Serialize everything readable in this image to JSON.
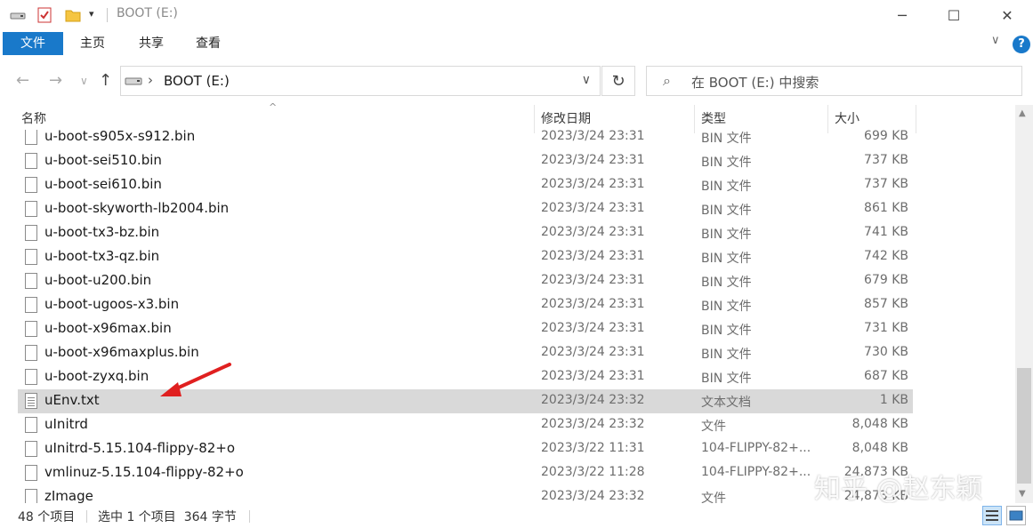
{
  "window": {
    "title": "BOOT (E:)",
    "minimize_glyph": "─",
    "maximize_glyph": "☐",
    "close_glyph": "✕"
  },
  "ribbon": {
    "tabs": [
      "文件",
      "主页",
      "共享",
      "查看"
    ],
    "help_glyph": "?",
    "expand_glyph": "∨"
  },
  "nav": {
    "back_glyph": "←",
    "forward_glyph": "→",
    "recent_glyph": "∨",
    "up_glyph": "↑",
    "address_text": "BOOT (E:)",
    "address_chevron": "›",
    "address_dropdown": "∨",
    "refresh_glyph": "↻",
    "search_placeholder": "在 BOOT (E:) 中搜索",
    "search_glyph": "⌕"
  },
  "columns": {
    "name": "名称",
    "date": "修改日期",
    "type": "类型",
    "size": "大小",
    "sort_glyph": "^"
  },
  "files": [
    {
      "name": "u-boot-s905x-s912.bin",
      "date": "2023/3/24 23:31",
      "type": "BIN 文件",
      "size": "699 KB",
      "icon": "file-icon",
      "selected": false
    },
    {
      "name": "u-boot-sei510.bin",
      "date": "2023/3/24 23:31",
      "type": "BIN 文件",
      "size": "737 KB",
      "icon": "file-icon",
      "selected": false
    },
    {
      "name": "u-boot-sei610.bin",
      "date": "2023/3/24 23:31",
      "type": "BIN 文件",
      "size": "737 KB",
      "icon": "file-icon",
      "selected": false
    },
    {
      "name": "u-boot-skyworth-lb2004.bin",
      "date": "2023/3/24 23:31",
      "type": "BIN 文件",
      "size": "861 KB",
      "icon": "file-icon",
      "selected": false
    },
    {
      "name": "u-boot-tx3-bz.bin",
      "date": "2023/3/24 23:31",
      "type": "BIN 文件",
      "size": "741 KB",
      "icon": "file-icon",
      "selected": false
    },
    {
      "name": "u-boot-tx3-qz.bin",
      "date": "2023/3/24 23:31",
      "type": "BIN 文件",
      "size": "742 KB",
      "icon": "file-icon",
      "selected": false
    },
    {
      "name": "u-boot-u200.bin",
      "date": "2023/3/24 23:31",
      "type": "BIN 文件",
      "size": "679 KB",
      "icon": "file-icon",
      "selected": false
    },
    {
      "name": "u-boot-ugoos-x3.bin",
      "date": "2023/3/24 23:31",
      "type": "BIN 文件",
      "size": "857 KB",
      "icon": "file-icon",
      "selected": false
    },
    {
      "name": "u-boot-x96max.bin",
      "date": "2023/3/24 23:31",
      "type": "BIN 文件",
      "size": "731 KB",
      "icon": "file-icon",
      "selected": false
    },
    {
      "name": "u-boot-x96maxplus.bin",
      "date": "2023/3/24 23:31",
      "type": "BIN 文件",
      "size": "730 KB",
      "icon": "file-icon",
      "selected": false
    },
    {
      "name": "u-boot-zyxq.bin",
      "date": "2023/3/24 23:31",
      "type": "BIN 文件",
      "size": "687 KB",
      "icon": "file-icon",
      "selected": false
    },
    {
      "name": "uEnv.txt",
      "date": "2023/3/24 23:32",
      "type": "文本文档",
      "size": "1 KB",
      "icon": "text-file-icon",
      "selected": true
    },
    {
      "name": "uInitrd",
      "date": "2023/3/24 23:32",
      "type": "文件",
      "size": "8,048 KB",
      "icon": "file-icon",
      "selected": false
    },
    {
      "name": "uInitrd-5.15.104-flippy-82+o",
      "date": "2023/3/22 11:31",
      "type": "104-FLIPPY-82+...",
      "size": "8,048 KB",
      "icon": "file-icon",
      "selected": false
    },
    {
      "name": "vmlinuz-5.15.104-flippy-82+o",
      "date": "2023/3/22 11:28",
      "type": "104-FLIPPY-82+...",
      "size": "24,873 KB",
      "icon": "file-icon",
      "selected": false
    },
    {
      "name": "zImage",
      "date": "2023/3/24 23:32",
      "type": "文件",
      "size": "24,873 KB",
      "icon": "file-icon",
      "selected": false
    }
  ],
  "status": {
    "item_count": "48 个项目",
    "selection": "选中 1 个项目  364 字节"
  },
  "watermark": "知乎 @赵东颖",
  "colors": {
    "accent": "#1979ca",
    "selected_row": "#d9d9d9",
    "annotation_arrow": "#e02020"
  }
}
